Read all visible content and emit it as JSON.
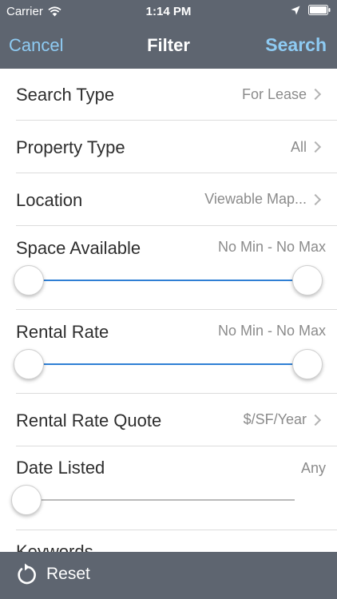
{
  "status_bar": {
    "carrier": "Carrier",
    "time": "1:14 PM"
  },
  "nav": {
    "cancel_label": "Cancel",
    "title": "Filter",
    "search_label": "Search"
  },
  "rows": {
    "search_type": {
      "label": "Search Type",
      "value": "For Lease"
    },
    "property_type": {
      "label": "Property Type",
      "value": "All"
    },
    "location": {
      "label": "Location",
      "value": "Viewable Map..."
    },
    "space_available": {
      "label": "Space Available",
      "value": "No Min - No Max",
      "range": [
        0,
        1
      ]
    },
    "rental_rate": {
      "label": "Rental Rate",
      "value": "No Min - No Max",
      "range": [
        0,
        1
      ]
    },
    "rental_rate_quote": {
      "label": "Rental Rate Quote",
      "value": "$/SF/Year"
    },
    "date_listed": {
      "label": "Date Listed",
      "value": "Any",
      "level": 0
    },
    "keywords": {
      "label": "Keywords"
    }
  },
  "bottom": {
    "reset_label": "Reset"
  },
  "colors": {
    "bar": "#5e6570",
    "accent": "#8ecbf3",
    "slider_fill": "#2f7fd4"
  },
  "icons": [
    "wifi-icon",
    "location-arrow-icon",
    "battery-icon",
    "chevron-right-icon",
    "reset-icon"
  ]
}
